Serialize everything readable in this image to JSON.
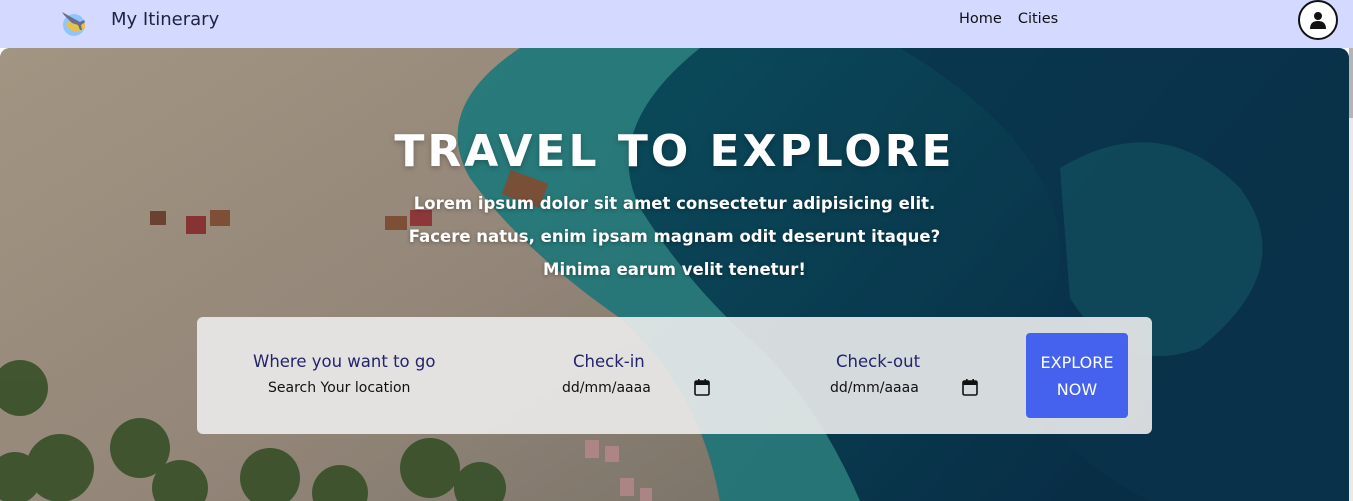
{
  "navbar": {
    "brand": "My Itinerary",
    "links": [
      "Home",
      "Cities"
    ],
    "logo_icon": "plane-globe-icon",
    "user_icon": "user-icon"
  },
  "hero": {
    "title": "TRAVEL TO EXPLORE",
    "lines": [
      "Lorem ipsum dolor sit amet consectetur adipisicing elit.",
      "Facere natus, enim ipsam magnam odit deserunt itaque?",
      "Minima earum velit tenetur!"
    ]
  },
  "search": {
    "location_label": "Where you want to go",
    "location_value": "Search Your location",
    "checkin_label": "Check-in",
    "checkin_value": "dd/mm/aaaa",
    "checkout_label": "Check-out",
    "checkout_value": "dd/mm/aaaa",
    "button_line1": "EXPLORE",
    "button_line2": "NOW"
  },
  "colors": {
    "navbar_bg": "#d3d9ff",
    "button_bg": "#4462ee",
    "label_color": "#23246b"
  }
}
